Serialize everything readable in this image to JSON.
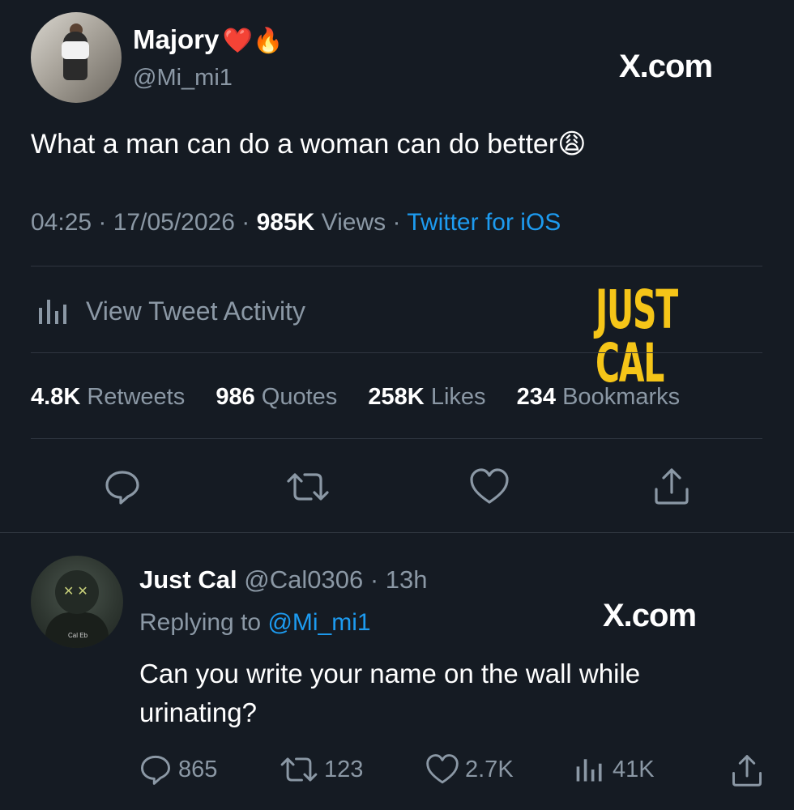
{
  "main_tweet": {
    "author_name": "Majory",
    "author_emojis": "❤️🔥",
    "handle": "@Mi_mi1",
    "watermark": "X.com",
    "text": "What a man can do a woman can do better😩",
    "time": "04:25",
    "date": "17/05/2026",
    "views_count": "985K",
    "views_label": "Views",
    "source": "Twitter for iOS",
    "activity_label": "View Tweet Activity",
    "brand_overlay": "JUST CAL",
    "stats": [
      {
        "count": "4.8K",
        "label": "Retweets"
      },
      {
        "count": "986",
        "label": "Quotes"
      },
      {
        "count": "258K",
        "label": "Likes"
      },
      {
        "count": "234",
        "label": "Bookmarks"
      }
    ],
    "actions": [
      "reply-icon",
      "retweet-icon",
      "like-icon",
      "share-icon"
    ]
  },
  "reply": {
    "author_name": "Just Cal",
    "handle": "@Cal0306",
    "age": "13h",
    "avatar_tag": "Cal Eb",
    "replying_label": "Replying to",
    "replying_to": "@Mi_mi1",
    "watermark": "X.com",
    "text": "Can you write your name on the wall while urinating?",
    "replies": "865",
    "retweets": "123",
    "likes": "2.7K",
    "views": "41K"
  },
  "colors": {
    "background": "#151b23",
    "link": "#1d9bf0",
    "muted": "#8b98a5",
    "brand_yellow": "#f5c518"
  }
}
